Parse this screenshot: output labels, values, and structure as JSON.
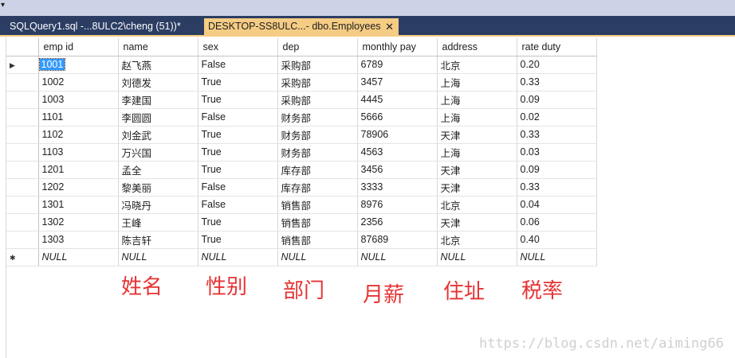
{
  "tabs": [
    {
      "label": "SQLQuery1.sql -...8ULC2\\cheng (51))*",
      "active": false
    },
    {
      "label": "DESKTOP-SS8ULC...- dbo.Employees",
      "active": true,
      "close": "✕"
    }
  ],
  "grid": {
    "columns": [
      "emp id",
      "name",
      "sex",
      "dep",
      "monthly pay",
      "address",
      "rate duty"
    ],
    "rows": [
      [
        "1001",
        "赵飞燕",
        "False",
        "采购部",
        "6789",
        "北京",
        "0.20"
      ],
      [
        "1002",
        "刘德发",
        "True",
        "采购部",
        "3457",
        "上海",
        "0.33"
      ],
      [
        "1003",
        "李建国",
        "True",
        "采购部",
        "4445",
        "上海",
        "0.09"
      ],
      [
        "1101",
        "李圆圆",
        "False",
        "财务部",
        "5666",
        "上海",
        "0.02"
      ],
      [
        "1102",
        "刘金武",
        "True",
        "财务部",
        "78906",
        "天津",
        "0.33"
      ],
      [
        "1103",
        "万兴国",
        "True",
        "财务部",
        "4563",
        "上海",
        "0.03"
      ],
      [
        "1201",
        "孟全",
        "True",
        "库存部",
        "3456",
        "天津",
        "0.09"
      ],
      [
        "1202",
        "黎美丽",
        "False",
        "库存部",
        "3333",
        "天津",
        "0.33"
      ],
      [
        "1301",
        "冯晓丹",
        "False",
        "销售部",
        "8976",
        "北京",
        "0.04"
      ],
      [
        "1302",
        "王峰",
        "True",
        "销售部",
        "2356",
        "天津",
        "0.06"
      ],
      [
        "1303",
        "陈吉轩",
        "True",
        "销售部",
        "87689",
        "北京",
        "0.40"
      ]
    ],
    "new_row": [
      "NULL",
      "NULL",
      "NULL",
      "NULL",
      "NULL",
      "NULL",
      "NULL"
    ],
    "current_row_marker": "▶",
    "new_row_marker": "✱"
  },
  "annotations": [
    "姓名",
    "性别",
    "部门",
    "月薪",
    "住址",
    "税率"
  ],
  "watermark": "https://blog.csdn.net/aiming66",
  "colors": {
    "tab_bar": "#2b3d63",
    "active_tab": "#f5cc84",
    "annotation": "#e53333",
    "selection": "#3399ff"
  }
}
